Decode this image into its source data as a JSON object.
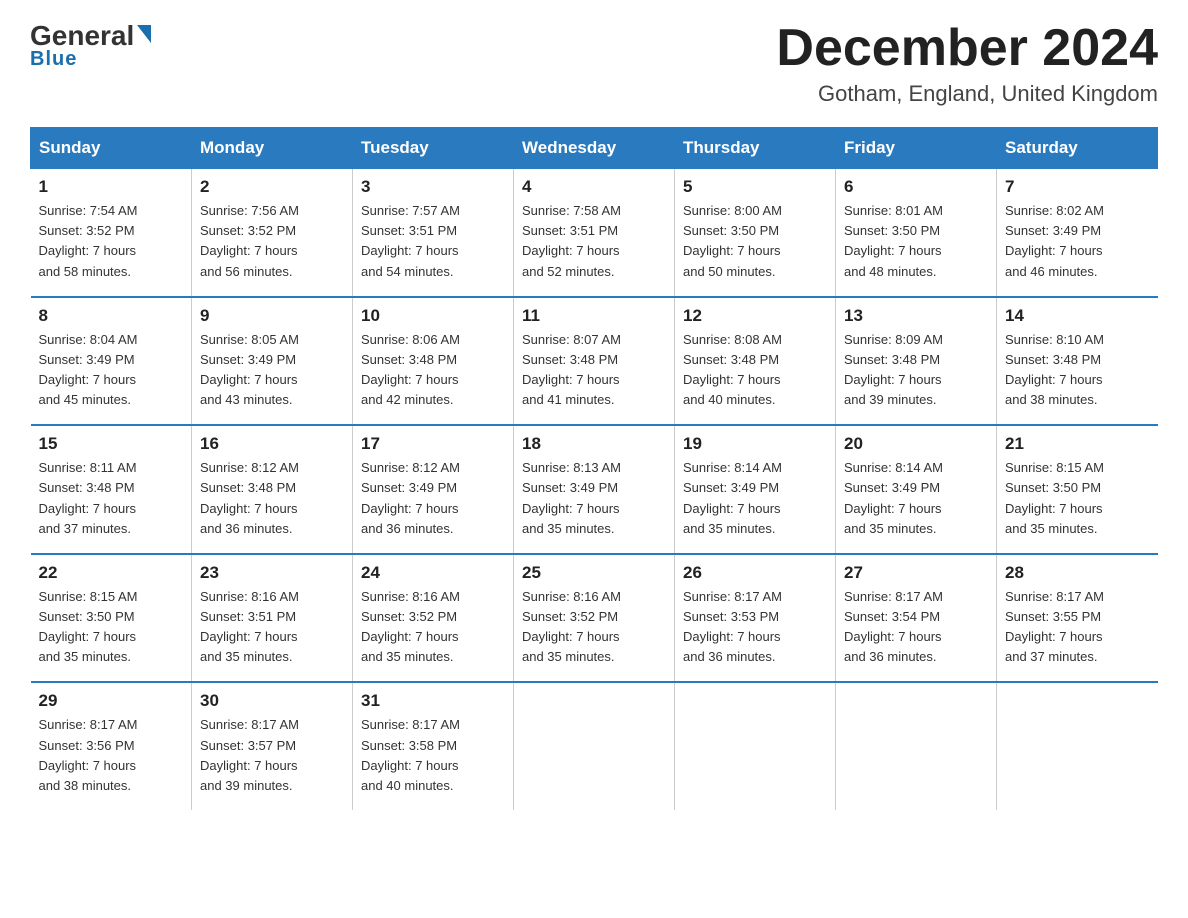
{
  "header": {
    "logo": {
      "general": "General",
      "blue": "Blue"
    },
    "title": "December 2024",
    "location": "Gotham, England, United Kingdom"
  },
  "weekdays": [
    "Sunday",
    "Monday",
    "Tuesday",
    "Wednesday",
    "Thursday",
    "Friday",
    "Saturday"
  ],
  "weeks": [
    [
      {
        "day": "1",
        "sunrise": "7:54 AM",
        "sunset": "3:52 PM",
        "daylight": "7 hours and 58 minutes."
      },
      {
        "day": "2",
        "sunrise": "7:56 AM",
        "sunset": "3:52 PM",
        "daylight": "7 hours and 56 minutes."
      },
      {
        "day": "3",
        "sunrise": "7:57 AM",
        "sunset": "3:51 PM",
        "daylight": "7 hours and 54 minutes."
      },
      {
        "day": "4",
        "sunrise": "7:58 AM",
        "sunset": "3:51 PM",
        "daylight": "7 hours and 52 minutes."
      },
      {
        "day": "5",
        "sunrise": "8:00 AM",
        "sunset": "3:50 PM",
        "daylight": "7 hours and 50 minutes."
      },
      {
        "day": "6",
        "sunrise": "8:01 AM",
        "sunset": "3:50 PM",
        "daylight": "7 hours and 48 minutes."
      },
      {
        "day": "7",
        "sunrise": "8:02 AM",
        "sunset": "3:49 PM",
        "daylight": "7 hours and 46 minutes."
      }
    ],
    [
      {
        "day": "8",
        "sunrise": "8:04 AM",
        "sunset": "3:49 PM",
        "daylight": "7 hours and 45 minutes."
      },
      {
        "day": "9",
        "sunrise": "8:05 AM",
        "sunset": "3:49 PM",
        "daylight": "7 hours and 43 minutes."
      },
      {
        "day": "10",
        "sunrise": "8:06 AM",
        "sunset": "3:48 PM",
        "daylight": "7 hours and 42 minutes."
      },
      {
        "day": "11",
        "sunrise": "8:07 AM",
        "sunset": "3:48 PM",
        "daylight": "7 hours and 41 minutes."
      },
      {
        "day": "12",
        "sunrise": "8:08 AM",
        "sunset": "3:48 PM",
        "daylight": "7 hours and 40 minutes."
      },
      {
        "day": "13",
        "sunrise": "8:09 AM",
        "sunset": "3:48 PM",
        "daylight": "7 hours and 39 minutes."
      },
      {
        "day": "14",
        "sunrise": "8:10 AM",
        "sunset": "3:48 PM",
        "daylight": "7 hours and 38 minutes."
      }
    ],
    [
      {
        "day": "15",
        "sunrise": "8:11 AM",
        "sunset": "3:48 PM",
        "daylight": "7 hours and 37 minutes."
      },
      {
        "day": "16",
        "sunrise": "8:12 AM",
        "sunset": "3:48 PM",
        "daylight": "7 hours and 36 minutes."
      },
      {
        "day": "17",
        "sunrise": "8:12 AM",
        "sunset": "3:49 PM",
        "daylight": "7 hours and 36 minutes."
      },
      {
        "day": "18",
        "sunrise": "8:13 AM",
        "sunset": "3:49 PM",
        "daylight": "7 hours and 35 minutes."
      },
      {
        "day": "19",
        "sunrise": "8:14 AM",
        "sunset": "3:49 PM",
        "daylight": "7 hours and 35 minutes."
      },
      {
        "day": "20",
        "sunrise": "8:14 AM",
        "sunset": "3:49 PM",
        "daylight": "7 hours and 35 minutes."
      },
      {
        "day": "21",
        "sunrise": "8:15 AM",
        "sunset": "3:50 PM",
        "daylight": "7 hours and 35 minutes."
      }
    ],
    [
      {
        "day": "22",
        "sunrise": "8:15 AM",
        "sunset": "3:50 PM",
        "daylight": "7 hours and 35 minutes."
      },
      {
        "day": "23",
        "sunrise": "8:16 AM",
        "sunset": "3:51 PM",
        "daylight": "7 hours and 35 minutes."
      },
      {
        "day": "24",
        "sunrise": "8:16 AM",
        "sunset": "3:52 PM",
        "daylight": "7 hours and 35 minutes."
      },
      {
        "day": "25",
        "sunrise": "8:16 AM",
        "sunset": "3:52 PM",
        "daylight": "7 hours and 35 minutes."
      },
      {
        "day": "26",
        "sunrise": "8:17 AM",
        "sunset": "3:53 PM",
        "daylight": "7 hours and 36 minutes."
      },
      {
        "day": "27",
        "sunrise": "8:17 AM",
        "sunset": "3:54 PM",
        "daylight": "7 hours and 36 minutes."
      },
      {
        "day": "28",
        "sunrise": "8:17 AM",
        "sunset": "3:55 PM",
        "daylight": "7 hours and 37 minutes."
      }
    ],
    [
      {
        "day": "29",
        "sunrise": "8:17 AM",
        "sunset": "3:56 PM",
        "daylight": "7 hours and 38 minutes."
      },
      {
        "day": "30",
        "sunrise": "8:17 AM",
        "sunset": "3:57 PM",
        "daylight": "7 hours and 39 minutes."
      },
      {
        "day": "31",
        "sunrise": "8:17 AM",
        "sunset": "3:58 PM",
        "daylight": "7 hours and 40 minutes."
      },
      null,
      null,
      null,
      null
    ]
  ],
  "labels": {
    "sunrise": "Sunrise:",
    "sunset": "Sunset:",
    "daylight": "Daylight:"
  }
}
